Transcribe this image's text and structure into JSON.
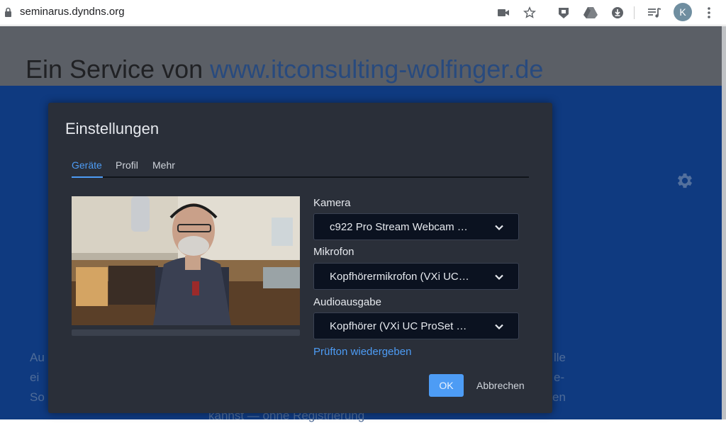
{
  "browser": {
    "url": "seminarus.dyndns.org",
    "avatar_letter": "K",
    "icons": [
      "lock-icon",
      "camera-icon",
      "star-icon",
      "extension-icon",
      "drive-icon",
      "download-icon",
      "playlist-icon",
      "menu-icon"
    ]
  },
  "page": {
    "heading_prefix": "Ein Service von ",
    "heading_link": "www.itconsulting-wolfinger.de",
    "bg_fragments": [
      "Au",
      "ei",
      "So",
      "lle",
      "e-",
      "en",
      "kannst — ohne Registrierung"
    ]
  },
  "dialog": {
    "title": "Einstellungen",
    "tabs": [
      "Geräte",
      "Profil",
      "Mehr"
    ],
    "active_tab": "Geräte",
    "camera_label": "Kamera",
    "camera_value": "c922 Pro Stream Webcam …",
    "mic_label": "Mikrofon",
    "mic_value": "Kopfhörermikrofon (VXi UC…",
    "audio_label": "Audioausgabe",
    "audio_value": "Kopfhörer (VXi UC ProSet …",
    "test_sound": "Prüfton wiedergeben",
    "ok": "OK",
    "cancel": "Abbrechen"
  },
  "colors": {
    "accent": "#4d9cf5",
    "dialog_bg": "#2a2f39",
    "page_blue": "#0f3a80",
    "select_bg": "#0b1220"
  }
}
